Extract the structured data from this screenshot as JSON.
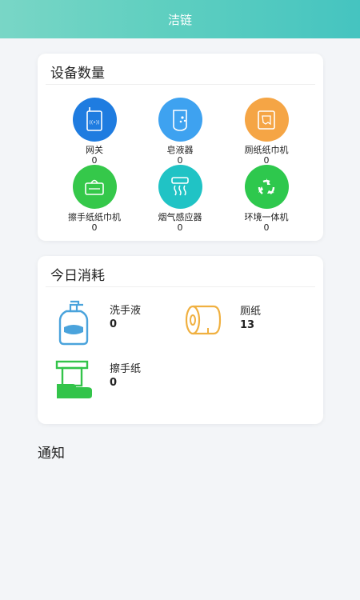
{
  "header": {
    "title": "洁链"
  },
  "devices": {
    "title": "设备数量",
    "items": [
      {
        "label": "网关",
        "count": "0",
        "color": "#1f7ce0",
        "icon": "gateway-icon"
      },
      {
        "label": "皂液器",
        "count": "0",
        "color": "#3ea2f0",
        "icon": "soap-dispenser-icon"
      },
      {
        "label": "厕纸纸巾机",
        "count": "0",
        "color": "#f5a545",
        "icon": "toilet-paper-dispenser-icon"
      },
      {
        "label": "擦手纸纸巾机",
        "count": "0",
        "color": "#35c84a",
        "icon": "hand-towel-dispenser-icon"
      },
      {
        "label": "烟气感应器",
        "count": "0",
        "color": "#20c3c5",
        "icon": "smoke-sensor-icon"
      },
      {
        "label": "环境一体机",
        "count": "0",
        "color": "#2ec84d",
        "icon": "environment-monitor-icon"
      }
    ]
  },
  "consumption": {
    "title": "今日消耗",
    "items": [
      {
        "label": "洗手液",
        "value": "0",
        "color": "#4aa3dc",
        "icon": "hand-soap-bottle-icon"
      },
      {
        "label": "厕纸",
        "value": "13",
        "color": "#f0b040",
        "icon": "toilet-roll-icon"
      },
      {
        "label": "擦手纸",
        "value": "0",
        "color": "#33c44a",
        "icon": "hand-towel-icon"
      }
    ]
  },
  "notices": {
    "title": "通知"
  }
}
